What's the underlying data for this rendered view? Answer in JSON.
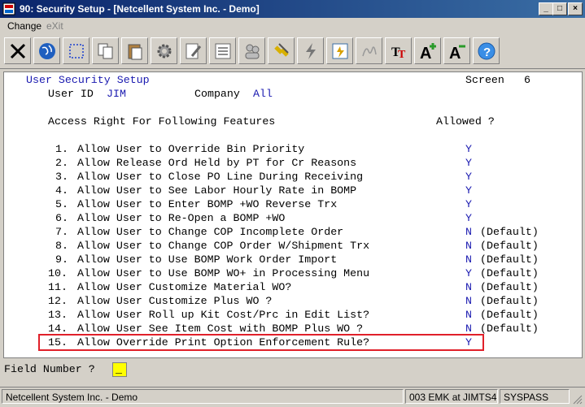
{
  "window": {
    "title": "90: Security Setup - [Netcellent System Inc. - Demo]",
    "min_symbol": "_",
    "max_symbol": "□",
    "close_symbol": "×"
  },
  "menu": [
    "Change",
    "eXit"
  ],
  "toolbar_icons": [
    "exit-icon",
    "globe-icon",
    "select-icon",
    "copy-icon",
    "paste-icon",
    "settings-icon",
    "edit-icon",
    "list-icon",
    "users-icon",
    "link-icon",
    "flash-icon",
    "calculator-icon",
    "signature-icon",
    "font-style-icon",
    "font-larger-icon",
    "font-smaller-icon",
    "help-icon"
  ],
  "screen": {
    "title": "User Security Setup",
    "screen_label": "Screen",
    "screen_number": "6",
    "user_id_label": "User ID",
    "user_id_value": "JIM",
    "company_label": "Company",
    "company_value": "All",
    "header_left": "Access Right For Following Features",
    "header_right": "Allowed ?",
    "rows": [
      {
        "num": "1.",
        "text": "Allow User to Override Bin Priority",
        "value": "Y",
        "default": ""
      },
      {
        "num": "2.",
        "text": "Allow Release Ord Held by PT for Cr Reasons",
        "value": "Y",
        "default": ""
      },
      {
        "num": "3.",
        "text": "Allow User to Close PO Line During Receiving",
        "value": "Y",
        "default": ""
      },
      {
        "num": "4.",
        "text": "Allow User to See Labor Hourly Rate in BOMP",
        "value": "Y",
        "default": ""
      },
      {
        "num": "5.",
        "text": "Allow User to Enter BOMP +WO Reverse Trx",
        "value": "Y",
        "default": ""
      },
      {
        "num": "6.",
        "text": "Allow User to Re-Open a BOMP +WO",
        "value": "Y",
        "default": ""
      },
      {
        "num": "7.",
        "text": "Allow User to Change COP Incomplete Order",
        "value": "N",
        "default": "(Default)"
      },
      {
        "num": "8.",
        "text": "Allow User to Change COP Order W/Shipment Trx",
        "value": "N",
        "default": "(Default)"
      },
      {
        "num": "9.",
        "text": "Allow User to Use BOMP Work Order Import",
        "value": "N",
        "default": "(Default)"
      },
      {
        "num": "10.",
        "text": "Allow User to Use BOMP WO+ in Processing Menu",
        "value": "Y",
        "default": "(Default)"
      },
      {
        "num": "11.",
        "text": "Allow User Customize Material WO?",
        "value": "N",
        "default": "(Default)"
      },
      {
        "num": "12.",
        "text": "Allow User Customize Plus WO ?",
        "value": "N",
        "default": "(Default)"
      },
      {
        "num": "13.",
        "text": "Allow User Roll up Kit Cost/Prc in Edit List?",
        "value": "N",
        "default": "(Default)"
      },
      {
        "num": "14.",
        "text": "Allow User See Item Cost with BOMP Plus WO ?",
        "value": "N",
        "default": "(Default)"
      },
      {
        "num": "15.",
        "text": "Allow Override Print Option Enforcement Rule?",
        "value": "Y",
        "default": ""
      }
    ]
  },
  "field_prompt": "Field Number ?",
  "field_value": "_",
  "status": {
    "company": "Netcellent System Inc. - Demo",
    "session": "003 EMK at JIMTS4",
    "db": "SYSPASS"
  }
}
